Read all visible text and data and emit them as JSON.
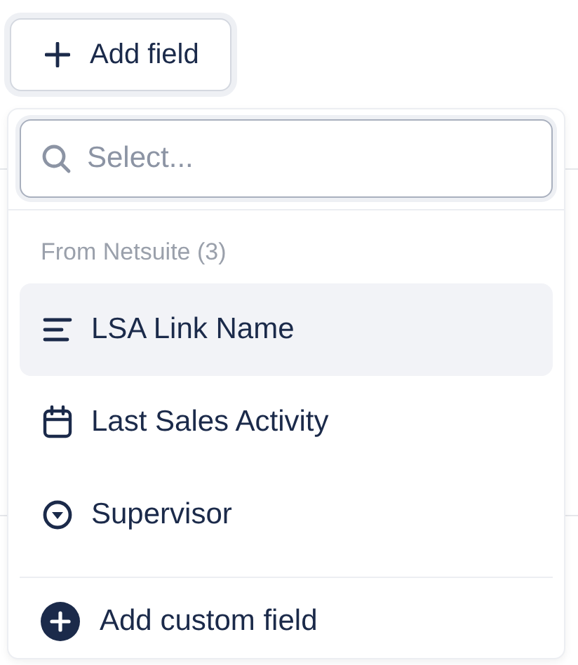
{
  "add_button": {
    "label": "Add field"
  },
  "search": {
    "placeholder": "Select..."
  },
  "group": {
    "label": "From Netsuite (3)"
  },
  "items": [
    {
      "label": "LSA Link Name",
      "kind": "text",
      "selected": true
    },
    {
      "label": "Last Sales Activity",
      "kind": "date",
      "selected": false
    },
    {
      "label": "Supervisor",
      "kind": "dropdown",
      "selected": false
    }
  ],
  "footer": {
    "label": "Add custom field"
  }
}
